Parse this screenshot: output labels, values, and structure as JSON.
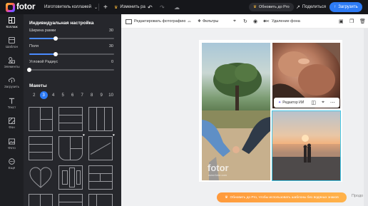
{
  "brand": {
    "logo": "fotor"
  },
  "topbar": {
    "mode_label": "Изготовитель коллажей",
    "resize_label": "Изменить ра",
    "pro_label": "Обновить до Pro",
    "share_label": "Поделиться",
    "upload_label": "Загрузить",
    "icons": [
      "chevron-down-icon",
      "plus-icon",
      "crown-icon",
      "undo-icon",
      "redo-icon",
      "cloud-icon",
      "crown-icon",
      "share-icon",
      "upload-icon"
    ]
  },
  "rail": {
    "items": [
      {
        "label": "Коллаж",
        "icon": "collage-icon",
        "active": true
      },
      {
        "label": "Шаблон",
        "icon": "template-icon",
        "active": false
      },
      {
        "label": "Элементы",
        "icon": "elements-icon",
        "active": false
      },
      {
        "label": "Загрузить",
        "icon": "upload-icon",
        "active": false
      },
      {
        "label": "Текст",
        "icon": "text-icon",
        "active": false
      },
      {
        "label": "Фон",
        "icon": "background-icon",
        "active": false
      },
      {
        "label": "Фото",
        "icon": "photo-icon",
        "active": false
      },
      {
        "label": "Ещё",
        "icon": "more-icon",
        "active": false
      }
    ]
  },
  "panel": {
    "title": "Индивидуальная настройка",
    "sliders": [
      {
        "label": "Ширина рамки",
        "value": "30",
        "fraction": 0.31
      },
      {
        "label": "Поля",
        "value": "30",
        "fraction": 0.31
      },
      {
        "label": "Угловой Радиус",
        "value": "0",
        "fraction": 0.0
      }
    ],
    "layouts_title": "Макеты",
    "page_numbers": [
      "2",
      "3",
      "4",
      "5",
      "6",
      "7",
      "8",
      "9",
      "10"
    ],
    "active_page": "3"
  },
  "toolbar": {
    "edit_photo_label": "Редактировать фотографию",
    "filters_label": "Фильтры",
    "remove_bg_label": "Удаление фона"
  },
  "canvas": {
    "watermark": "fotor",
    "watermark_sub": "www.fotor.com"
  },
  "float_toolbar": {
    "ai_editor_label": "Редактор ИИ"
  },
  "promo": {
    "text": "Обновить до Pro, чтобы использовать шаблоны без водяных знаков",
    "side": "Продо"
  },
  "colors": {
    "accent": "#2d7bf5",
    "selection": "#44c7e8",
    "promo": "#ff9a3c",
    "dark": "#16171b"
  }
}
